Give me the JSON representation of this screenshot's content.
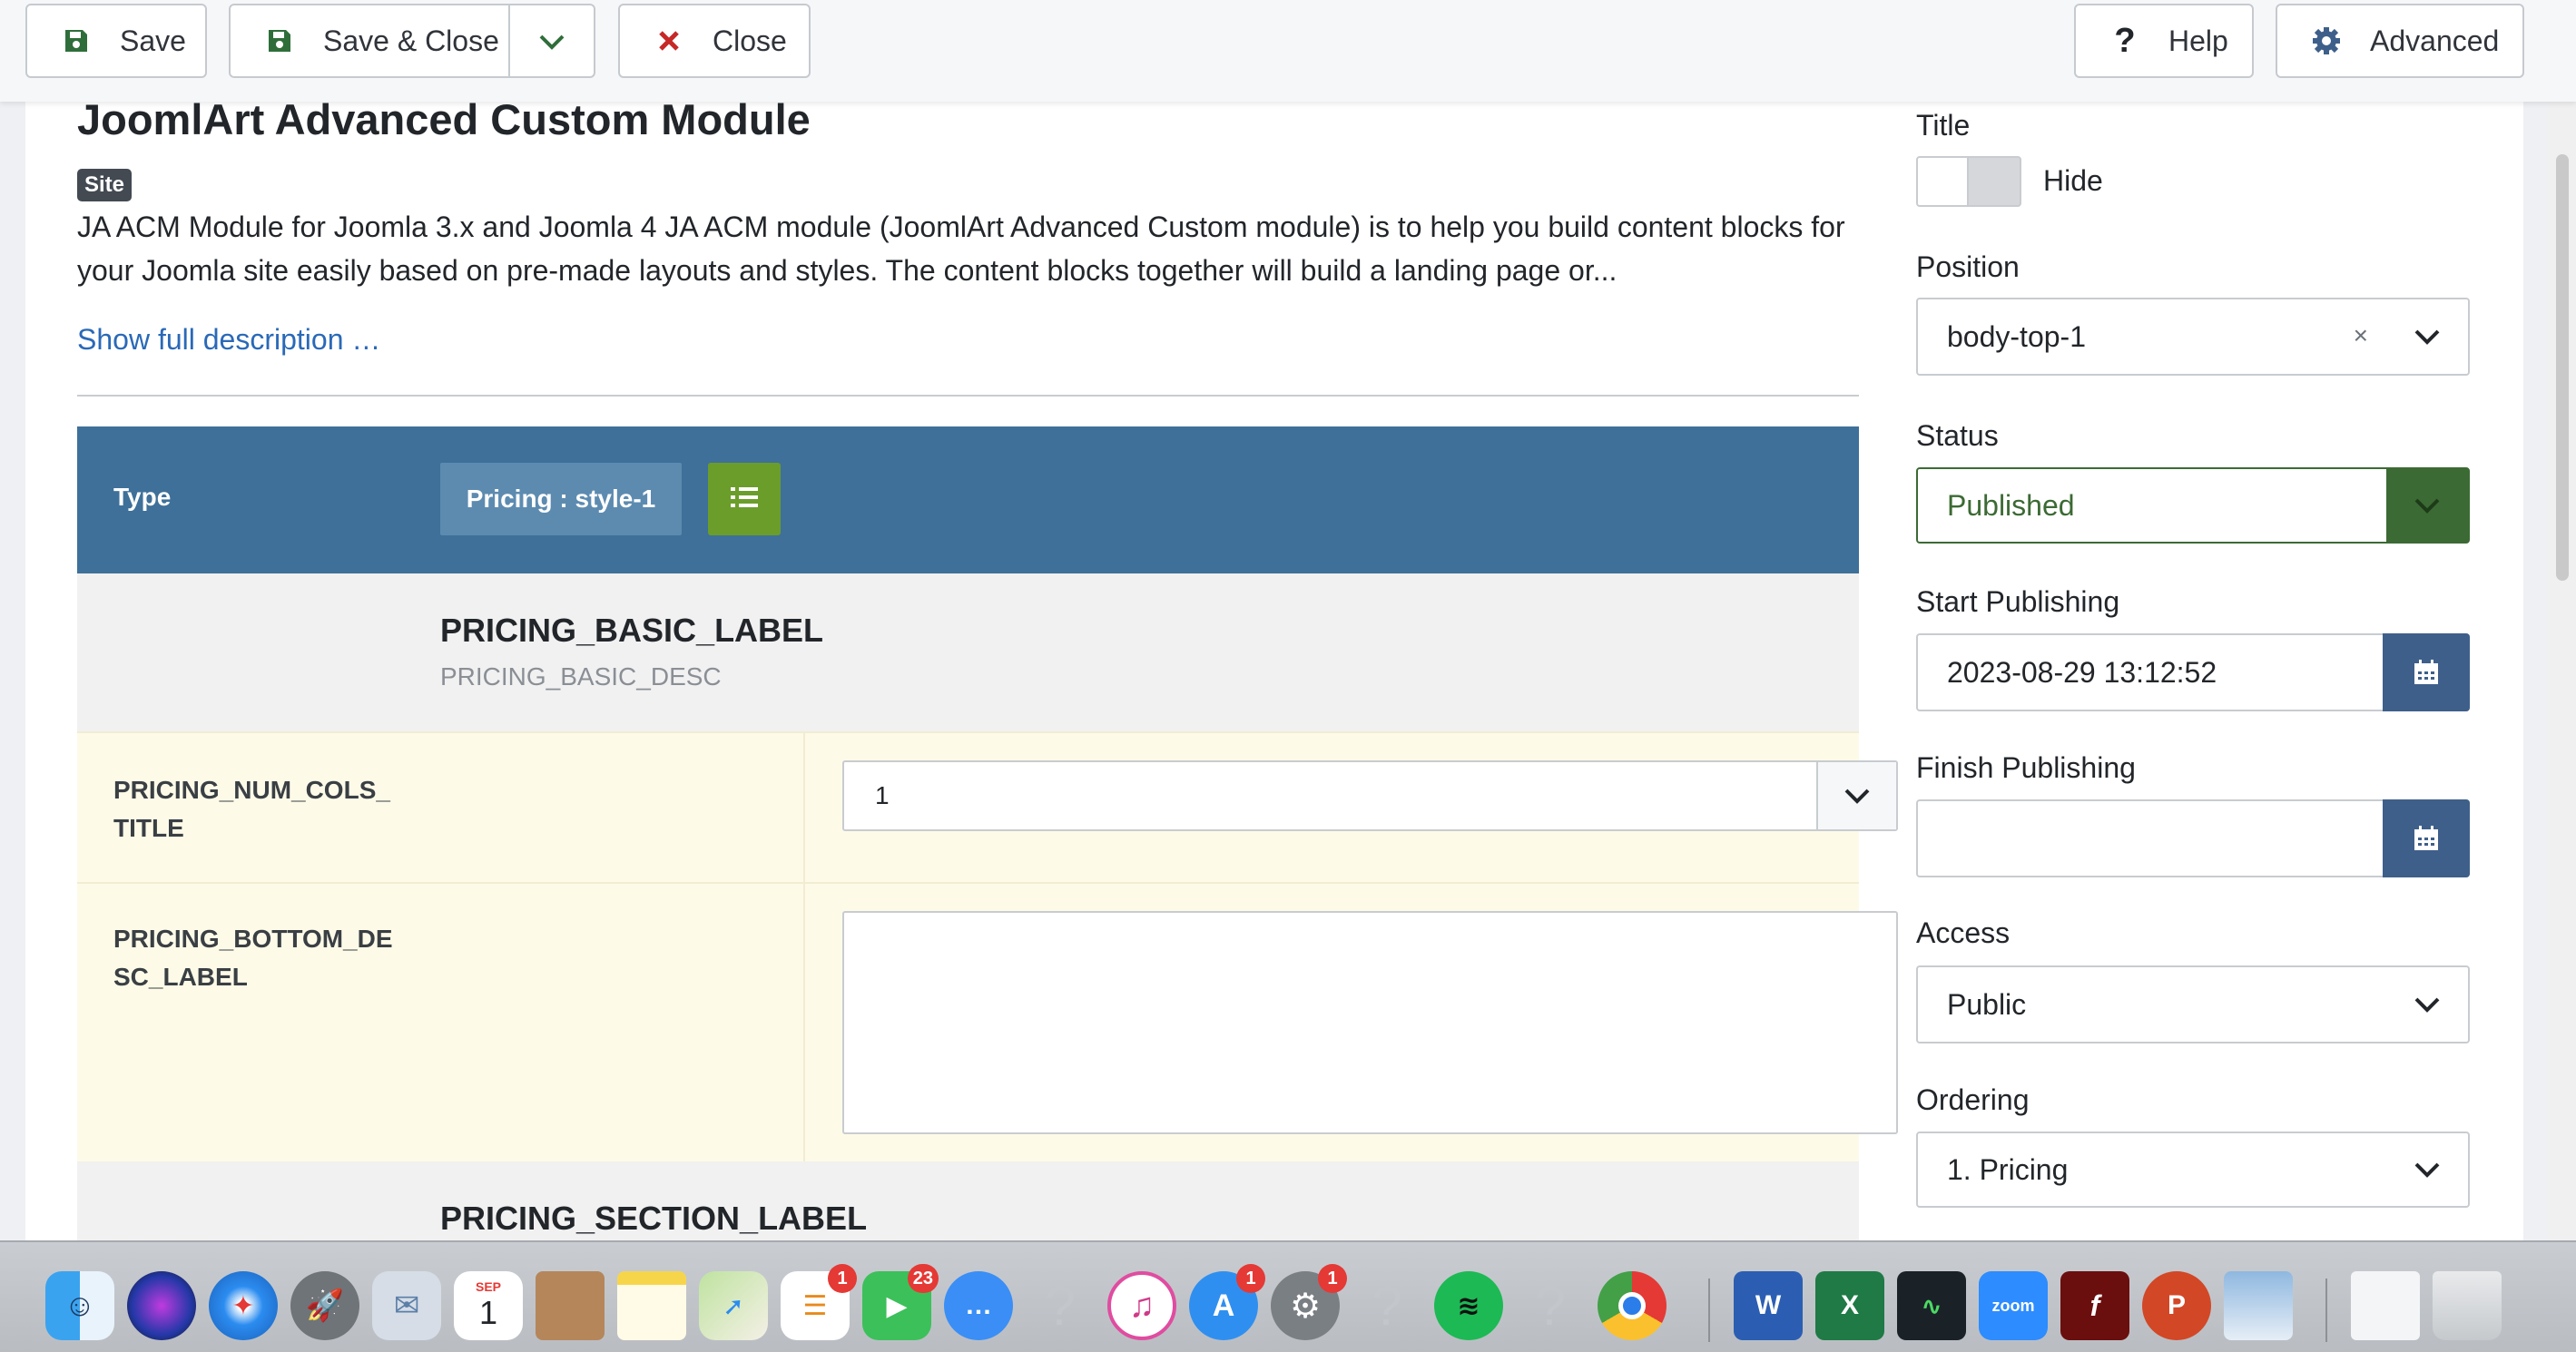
{
  "toolbar": {
    "save_label": "Save",
    "save_close_label": "Save & Close",
    "close_label": "Close",
    "help_label": "Help",
    "advanced_label": "Advanced"
  },
  "module": {
    "title": "JoomlArt Advanced Custom Module",
    "badge": "Site",
    "description": "JA ACM Module for Joomla 3.x and Joomla 4 JA ACM module (JoomlArt Advanced Custom module) is to help you build content blocks for your Joomla site easily based on pre-made layouts and styles. The content blocks together will build a landing page or...",
    "show_full_description": "Show full description …"
  },
  "type_bar": {
    "label": "Type",
    "style_value": "Pricing : style-1"
  },
  "sections": [
    {
      "heading": "PRICING_BASIC_LABEL",
      "desc": "PRICING_BASIC_DESC"
    },
    {
      "heading": "PRICING_SECTION_LABEL"
    }
  ],
  "fields": [
    {
      "label": "PRICING_NUM_COLS_ TITLE",
      "value": "1"
    },
    {
      "label": "PRICING_BOTTOM_DE SC_LABEL",
      "value": ""
    }
  ],
  "side": {
    "title_label": "Title",
    "title_toggle": "Hide",
    "position_label": "Position",
    "position_value": "body-top-1",
    "position_clear": "×",
    "status_label": "Status",
    "status_value": "Published",
    "start_label": "Start Publishing",
    "start_value": "2023-08-29 13:12:52",
    "finish_label": "Finish Publishing",
    "finish_value": "",
    "access_label": "Access",
    "access_value": "Public",
    "ordering_label": "Ordering",
    "ordering_value": "1. Pricing"
  },
  "dock": {
    "calendar_month": "SEP",
    "calendar_day": "1",
    "reminders_badge": "1",
    "facetime_badge": "23",
    "appstore_badge": "1",
    "prefs_badge": "1",
    "zoom_label": "zoom"
  },
  "colors": {
    "type_bar": "#3e7099",
    "status_green": "#3c6a34",
    "calendar_btn": "#3e5f8a",
    "link_blue": "#2a69b8"
  }
}
